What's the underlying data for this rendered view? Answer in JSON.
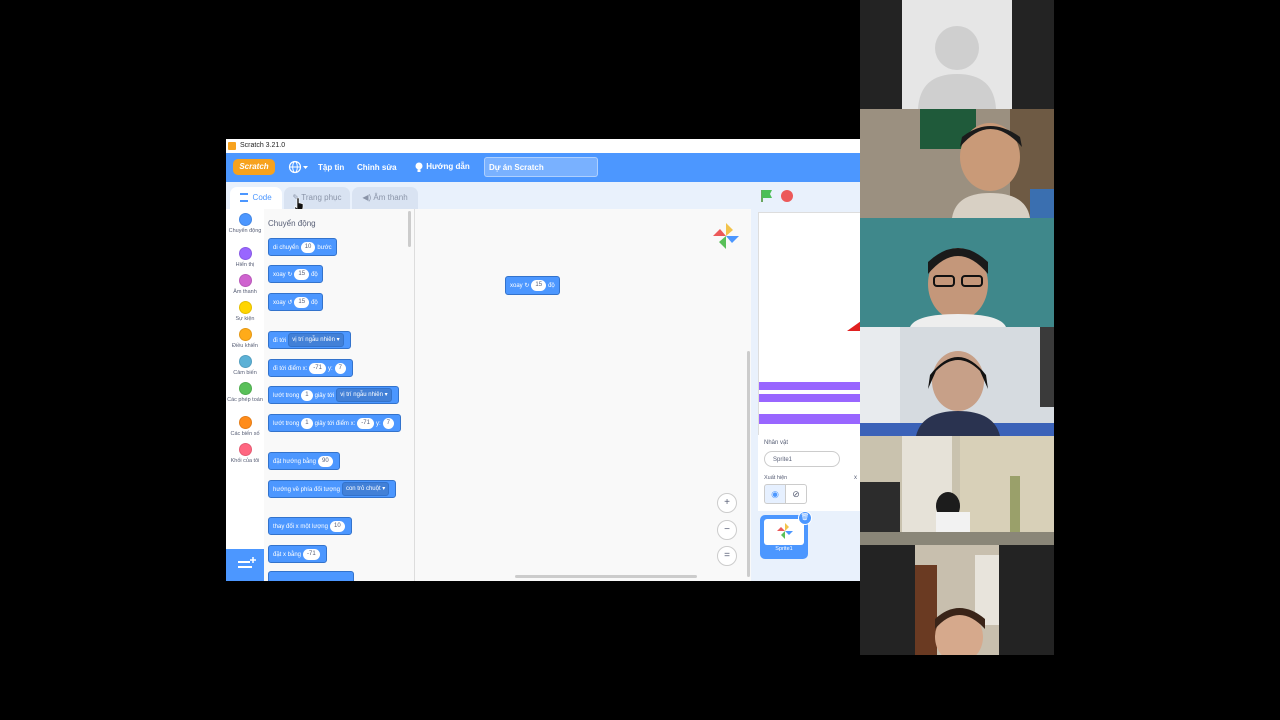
{
  "window": {
    "title": "Scratch 3.21.0"
  },
  "menu": {
    "logo": "Scratch",
    "file": "Tập tin",
    "edit": "Chỉnh sửa",
    "tutorials": "Hướng dẫn",
    "project_title": "Dự án Scratch"
  },
  "tabs": {
    "code": "Code",
    "costumes": "Trang phục",
    "sounds": "Âm thanh"
  },
  "categories": [
    {
      "label": "Chuyển động",
      "color": "#4c97ff"
    },
    {
      "label": "Hiển thị",
      "color": "#9966ff"
    },
    {
      "label": "Âm thanh",
      "color": "#cf63cf"
    },
    {
      "label": "Sự kiện",
      "color": "#ffd500"
    },
    {
      "label": "Điều khiển",
      "color": "#ffab19"
    },
    {
      "label": "Cảm biến",
      "color": "#5cb1d6"
    },
    {
      "label": "Các phép toán",
      "color": "#59c059"
    },
    {
      "label": "Các biến số",
      "color": "#ff8c1a"
    },
    {
      "label": "Khối của tôi",
      "color": "#ff6680"
    }
  ],
  "palette": {
    "heading": "Chuyển động",
    "move": {
      "a": "di chuyển",
      "v": "10",
      "b": "bước"
    },
    "turn_right": {
      "a": "xoay",
      "v": "15",
      "b": "độ"
    },
    "turn_left": {
      "a": "xoay",
      "v": "15",
      "b": "độ"
    },
    "goto": {
      "a": "đi tới",
      "dd": "vị trí ngẫu nhiên"
    },
    "goto_xy": {
      "a": "đi tới điểm x:",
      "x": "-71",
      "yl": "y:",
      "y": "7"
    },
    "glide": {
      "a": "lướt trong",
      "v": "1",
      "b": "giây tới",
      "dd": "vị trí ngẫu nhiên"
    },
    "glide_xy": {
      "a": "lướt trong",
      "v": "1",
      "b": "giây tới điểm x:",
      "x": "-71",
      "yl": "y:",
      "y": "7"
    },
    "point_dir": {
      "a": "đặt hướng bằng",
      "v": "90"
    },
    "point_towards": {
      "a": "hướng về phía đối tượng",
      "dd": "con trỏ chuột"
    },
    "change_x": {
      "a": "thay đổi x một lượng",
      "v": "10"
    },
    "set_x": {
      "a": "đặt x bằng",
      "v": "-71"
    }
  },
  "script_block": {
    "a": "xoay",
    "v": "15",
    "b": "độ"
  },
  "zoom": {
    "in": "+",
    "out": "−",
    "reset": "="
  },
  "sprite_info": {
    "sprite_label": "Nhân vật",
    "sprite_name": "Sprite1",
    "show_label": "Xuất hiện",
    "x_abbr": "x"
  },
  "sprite_tile": {
    "name": "Sprite1"
  },
  "colors": {
    "accent": "#4c97ff",
    "motion": "#4c97ff",
    "purple": "#9966ff"
  }
}
